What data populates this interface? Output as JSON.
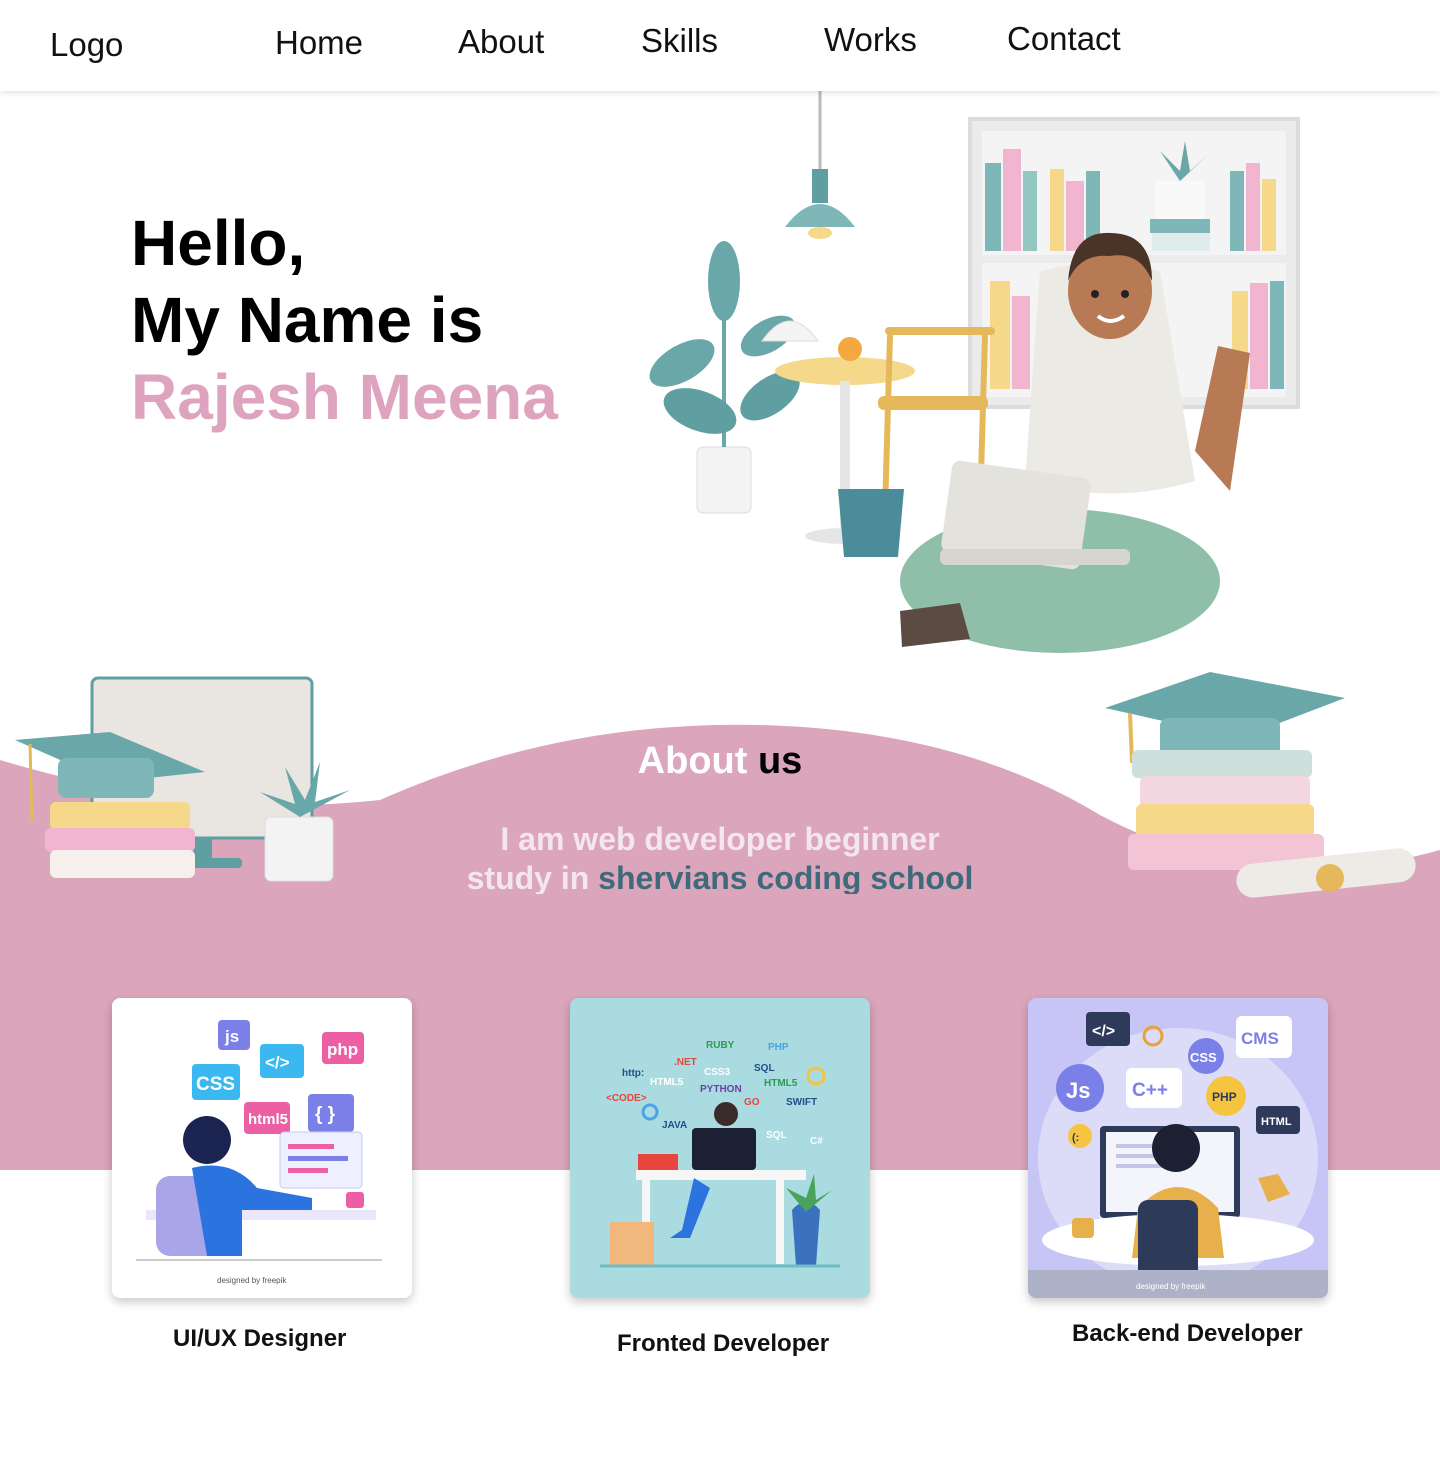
{
  "nav": {
    "logo": "Logo",
    "items": [
      {
        "label": "Home"
      },
      {
        "label": "About"
      },
      {
        "label": "Skills"
      },
      {
        "label": "Works"
      },
      {
        "label": "Contact"
      }
    ]
  },
  "hero": {
    "line1": "Hello,",
    "line2": "My Name is",
    "name": "Rajesh Meena",
    "name_color": "#dea4bf"
  },
  "about": {
    "heading_part1": "About ",
    "heading_part2": "us",
    "text_line1": "I am web developer beginner",
    "text_line2_prefix": "study in ",
    "text_line2_highlight": "shervians coding school",
    "band_color": "#dba5bc",
    "highlight_color": "#3f6a7a"
  },
  "cards": [
    {
      "label": "UI/UX Designer",
      "tags": [
        "js",
        "php",
        "CSS",
        "</>",
        "html5",
        "{ }"
      ],
      "credit": "designed by freepik"
    },
    {
      "label": "Fronted Developer",
      "tags": [
        "RUBY",
        "PHP",
        ".NET",
        "CSS3",
        "SQL",
        "http:",
        "HTML5",
        "PYTHON",
        "HTML5",
        "<CODE>",
        "GO",
        "SWIFT",
        "JAVA",
        "SQL",
        "C#"
      ]
    },
    {
      "label": "Back-end Developer",
      "tags": [
        "</>",
        "CMS",
        "CSS",
        "Js",
        "C++",
        "PHP",
        "HTML",
        "(:"
      ],
      "credit": "designed by freepik"
    }
  ]
}
